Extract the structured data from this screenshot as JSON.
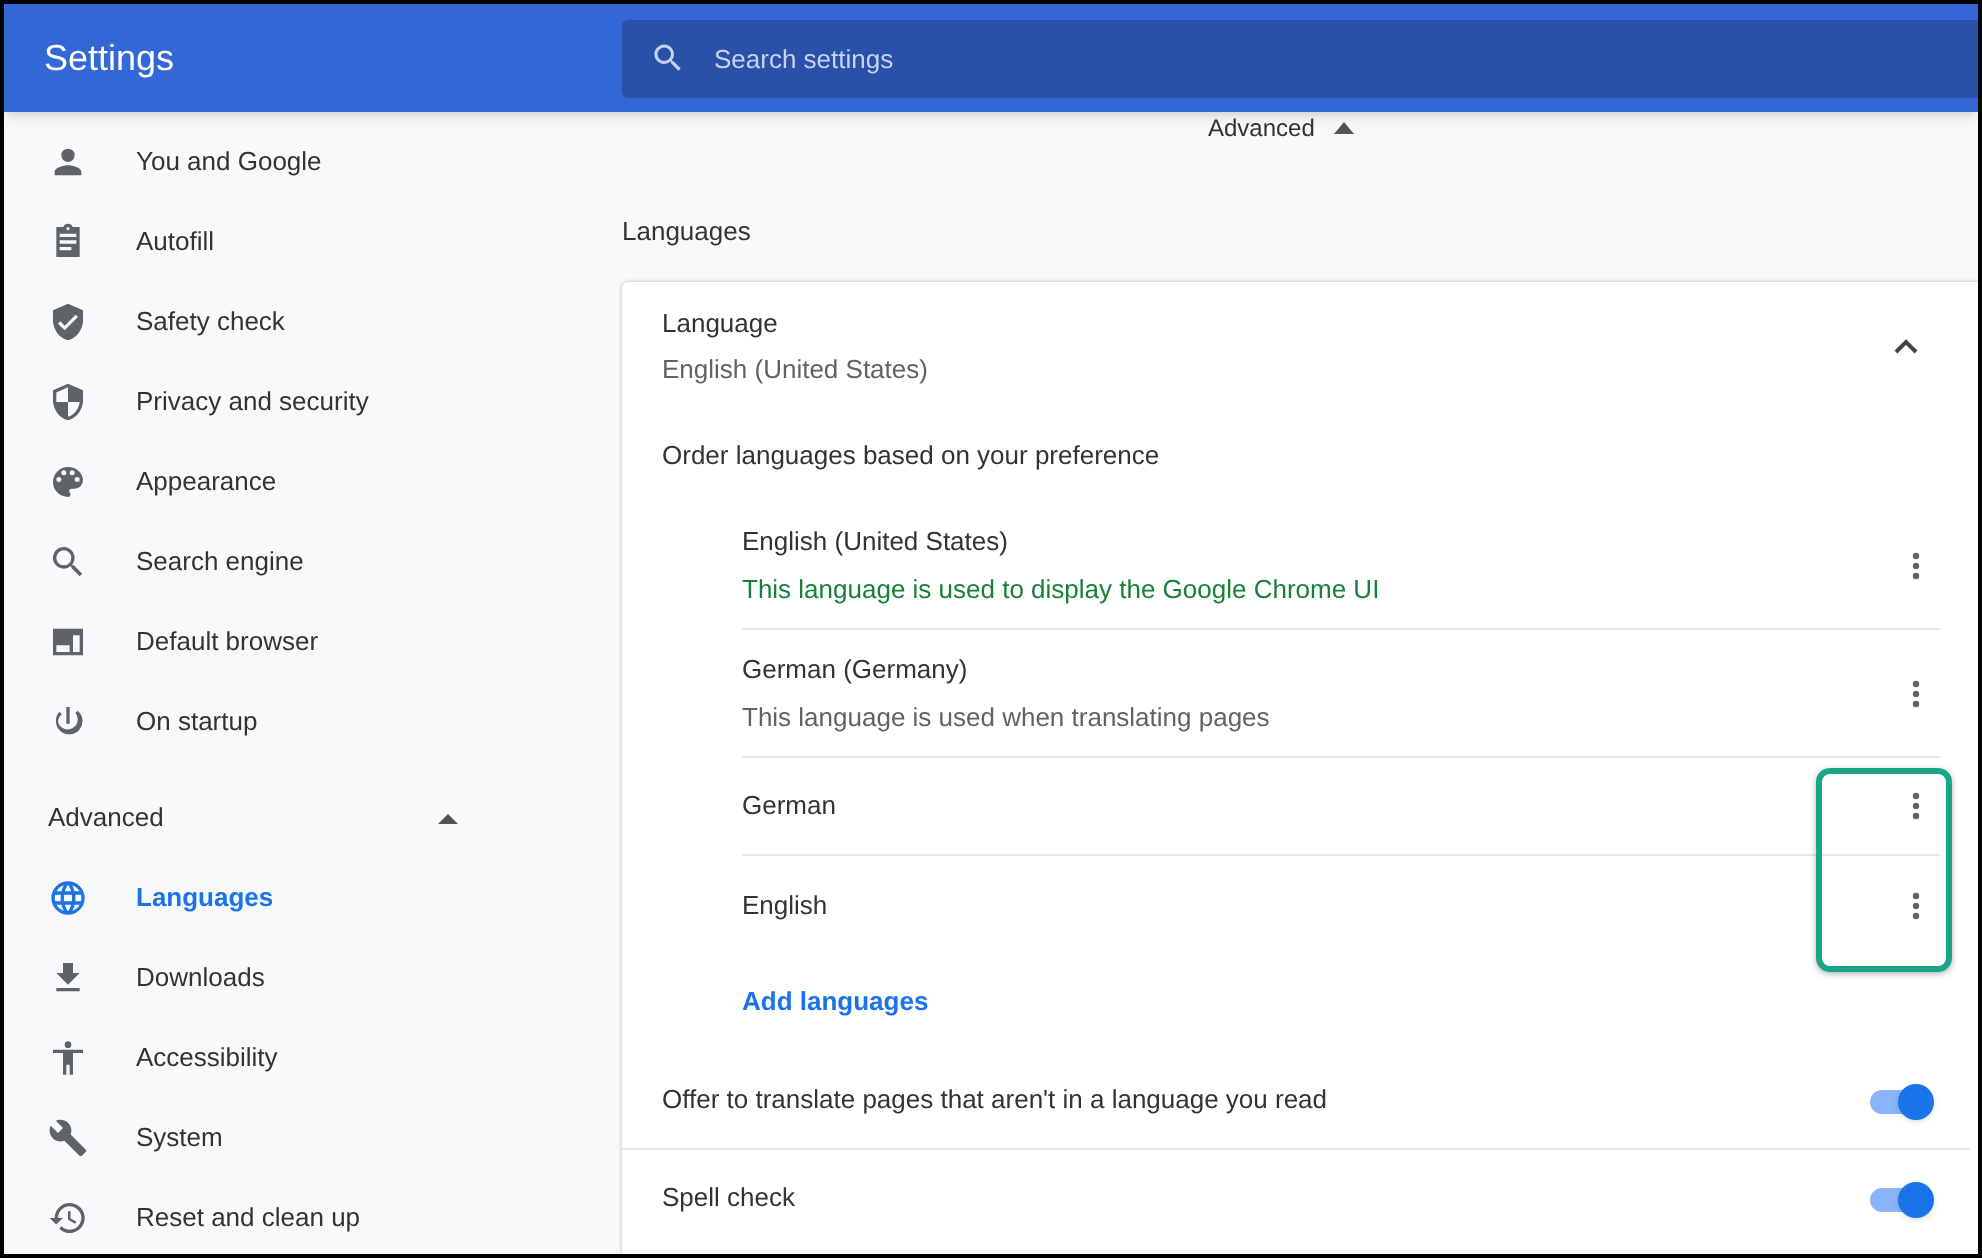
{
  "header": {
    "title": "Settings",
    "search": {
      "placeholder": "Search settings"
    }
  },
  "sidebar": {
    "items": [
      {
        "label": "You and Google",
        "kind": "person",
        "selected": false
      },
      {
        "label": "Autofill",
        "kind": "clipboard",
        "selected": false
      },
      {
        "label": "Safety check",
        "kind": "shield-check",
        "selected": false
      },
      {
        "label": "Privacy and security",
        "kind": "shield-half",
        "selected": false
      },
      {
        "label": "Appearance",
        "kind": "palette",
        "selected": false
      },
      {
        "label": "Search engine",
        "kind": "search",
        "selected": false
      },
      {
        "label": "Default browser",
        "kind": "browser",
        "selected": false
      },
      {
        "label": "On startup",
        "kind": "power",
        "selected": false
      }
    ],
    "advanced": {
      "label": "Advanced",
      "expanded": true,
      "items": [
        {
          "label": "Languages",
          "kind": "globe",
          "selected": true
        },
        {
          "label": "Downloads",
          "kind": "download",
          "selected": false
        },
        {
          "label": "Accessibility",
          "kind": "accessibility",
          "selected": false
        },
        {
          "label": "System",
          "kind": "wrench",
          "selected": false
        },
        {
          "label": "Reset and clean up",
          "kind": "history",
          "selected": false
        }
      ]
    }
  },
  "main": {
    "advanced_toggle": {
      "label": "Advanced",
      "expanded": true
    },
    "section_title": "Languages",
    "language": {
      "label": "Language",
      "value": "English (United States)",
      "expanded": true
    },
    "order_label": "Order languages based on your preference",
    "languages": [
      {
        "name": "English (United States)",
        "note": "This language is used to display the Google Chrome UI",
        "kind": "ui",
        "highlighted": false
      },
      {
        "name": "German (Germany)",
        "note": "This language is used when translating pages",
        "kind": "translate",
        "highlighted": false
      },
      {
        "name": "German",
        "kind": "plain",
        "highlighted": true
      },
      {
        "name": "English",
        "kind": "plain",
        "highlighted": true
      }
    ],
    "add_languages": "Add languages",
    "toggles": [
      {
        "label": "Offer to translate pages that aren't in a language you read",
        "on": true
      },
      {
        "label": "Spell check",
        "on": true
      }
    ]
  }
}
